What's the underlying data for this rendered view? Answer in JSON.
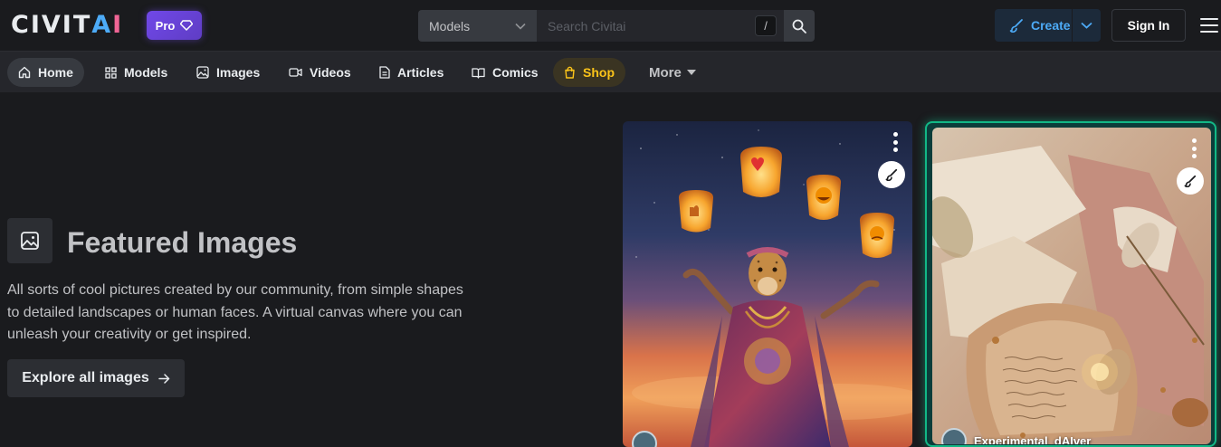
{
  "header": {
    "logo_letters": [
      "C",
      "I",
      "V",
      "I",
      "T",
      "A",
      "I"
    ],
    "logo_colors": [
      "#e9ecef",
      "#e9ecef",
      "#e9ecef",
      "#e9ecef",
      "#e9ecef",
      "#4dabf7",
      "#f06595"
    ],
    "pro_label": "Pro",
    "search_type": "Models",
    "search_placeholder": "Search Civitai",
    "search_shortcut": "/",
    "create_label": "Create",
    "signin_label": "Sign In"
  },
  "nav": {
    "items": [
      {
        "label": "Home",
        "icon": "home-icon"
      },
      {
        "label": "Models",
        "icon": "grid-icon"
      },
      {
        "label": "Images",
        "icon": "image-icon"
      },
      {
        "label": "Videos",
        "icon": "video-icon"
      },
      {
        "label": "Articles",
        "icon": "file-icon"
      },
      {
        "label": "Comics",
        "icon": "book-icon"
      },
      {
        "label": "Shop",
        "icon": "shopping-bag-icon"
      }
    ],
    "more_label": "More"
  },
  "hero": {
    "title": "Featured Images",
    "description": "All sorts of cool pictures created by our community, from simple shapes to detailed landscapes or human faces. A virtual canvas where you can unleash your creativity or get inspired.",
    "explore_label": "Explore all images"
  },
  "cards": [
    {
      "user": ""
    },
    {
      "user": "Experimental_dAIver"
    }
  ],
  "colors": {
    "accent_blue": "#4dabf7",
    "pro_purple": "#7048e8",
    "shop_yellow": "#fcc419",
    "featured_border": "#12b886"
  }
}
